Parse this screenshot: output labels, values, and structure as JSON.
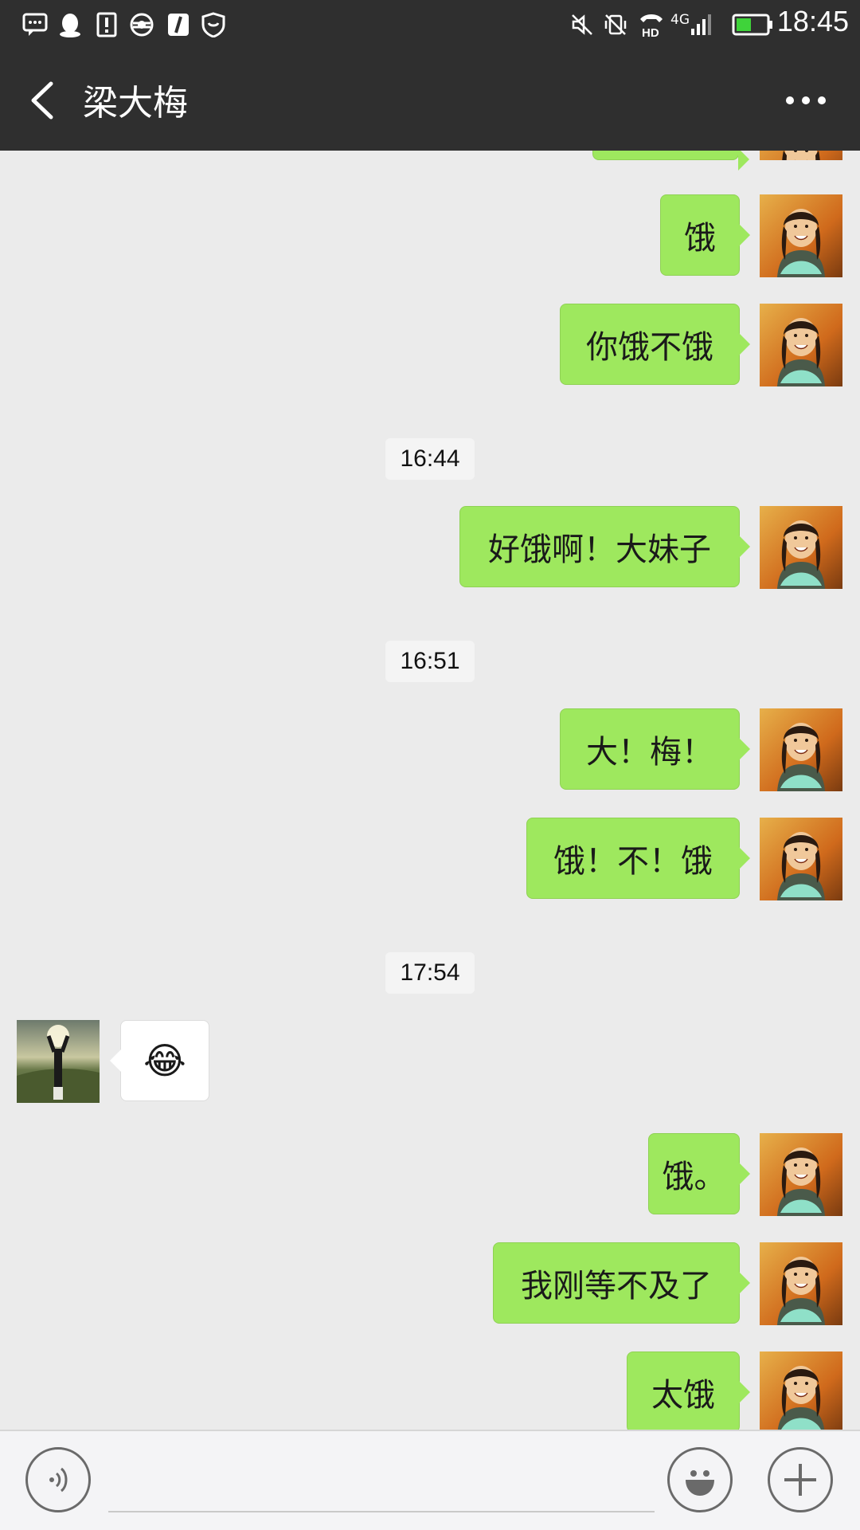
{
  "status_bar": {
    "time": "18:45",
    "network": "4G",
    "hd_label": "HD",
    "left_icons": [
      "message-icon",
      "qq-icon",
      "alert-icon",
      "browser-icon",
      "music-icon",
      "shield-icon"
    ],
    "right_icons": [
      "mute-icon",
      "vibrate-off-icon",
      "hd-call-icon",
      "signal-icon",
      "battery-icon"
    ]
  },
  "nav": {
    "title": "梁大梅",
    "back_icon": "back-chevron-icon",
    "more_icon": "more-dots-icon"
  },
  "messages": [
    {
      "type": "partial-self",
      "text": ""
    },
    {
      "type": "self",
      "text": "饿"
    },
    {
      "type": "self",
      "text": "你饿不饿"
    },
    {
      "type": "time",
      "text": "16:44"
    },
    {
      "type": "self",
      "text": "好饿啊！大妹子"
    },
    {
      "type": "time",
      "text": "16:51"
    },
    {
      "type": "self",
      "text": "大！梅！"
    },
    {
      "type": "self",
      "text": "饿！不！饿"
    },
    {
      "type": "time",
      "text": "17:54"
    },
    {
      "type": "other",
      "text": "😂"
    },
    {
      "type": "self",
      "text": "饿。"
    },
    {
      "type": "self",
      "text": "我刚等不及了"
    },
    {
      "type": "self",
      "text": "太饿"
    }
  ],
  "input_bar": {
    "voice_icon": "voice-icon",
    "emoji_icon": "emoji-icon",
    "plus_icon": "plus-icon",
    "placeholder": ""
  },
  "colors": {
    "bar": "#2f2f2f",
    "chat_bg": "#ebebeb",
    "self_bubble": "#9ee85e",
    "other_bubble": "#ffffff"
  }
}
